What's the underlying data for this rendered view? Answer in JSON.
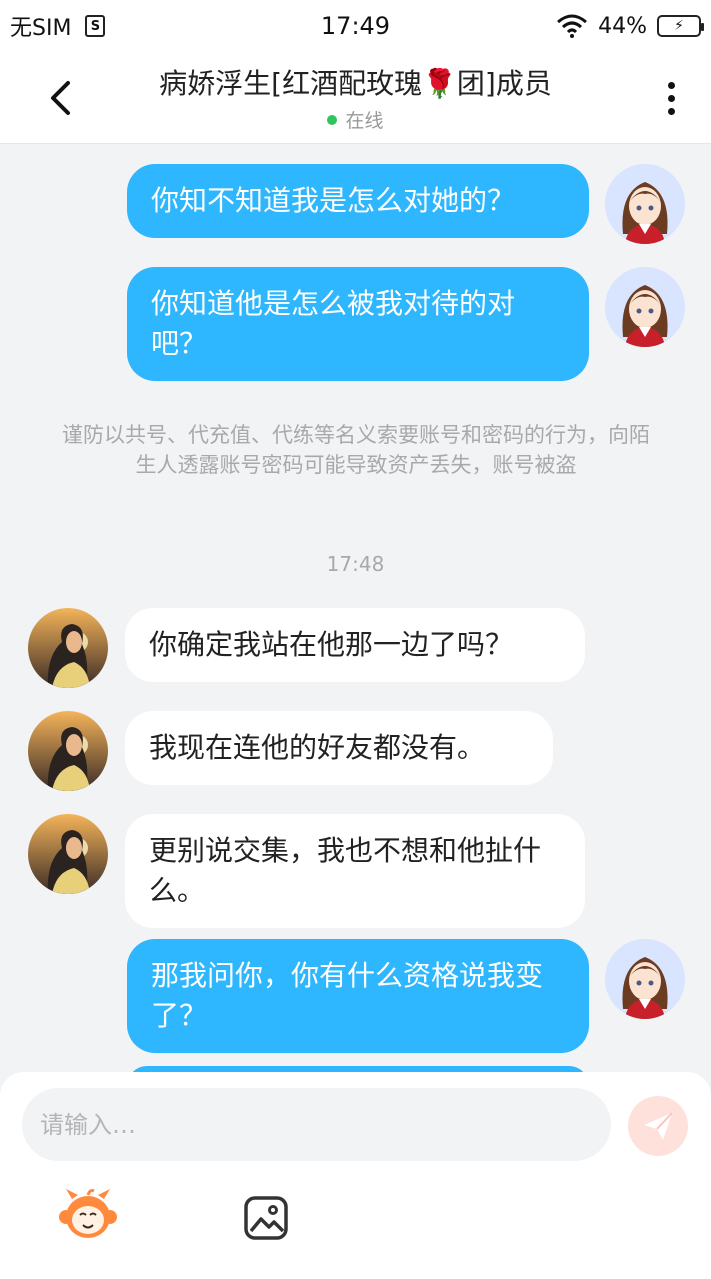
{
  "status_bar": {
    "carrier": "无SIM",
    "sim_icon_letter": "S",
    "time": "17:49",
    "battery": "44%"
  },
  "header": {
    "title": "病娇浮生[红酒配玫瑰🌹团]成员",
    "status": "在线"
  },
  "messages": [
    {
      "from": "me",
      "text": "你知不知道我是怎么对她的？"
    },
    {
      "from": "me",
      "text": "你知道他是怎么被我对待的对吧？"
    },
    {
      "from": "system",
      "text": "谨防以共号、代充值、代练等名义索要账号和密码的行为，向陌生人透露账号密码可能导致资产丢失，账号被盗"
    },
    {
      "from": "time",
      "text": "17:48"
    },
    {
      "from": "other",
      "text": "你确定我站在他那一边了吗？"
    },
    {
      "from": "other",
      "text": "我现在连他的好友都没有。"
    },
    {
      "from": "other",
      "text": "更别说交集，我也不想和他扯什么。"
    },
    {
      "from": "me",
      "text": "那我问你，你有什么资格说我变了？"
    }
  ],
  "input": {
    "placeholder": "请输入…"
  },
  "colors": {
    "my_bubble": "#2eb6ff",
    "other_bubble": "#ffffff",
    "background": "#f2f3f5",
    "online": "#2ec55d",
    "send_button": "#ffe1dc"
  },
  "icons": {
    "back": "chevron-left-icon",
    "more": "more-vertical-icon",
    "send": "paper-plane-icon",
    "emoji": "monkey-emoji-icon",
    "image": "image-icon"
  }
}
